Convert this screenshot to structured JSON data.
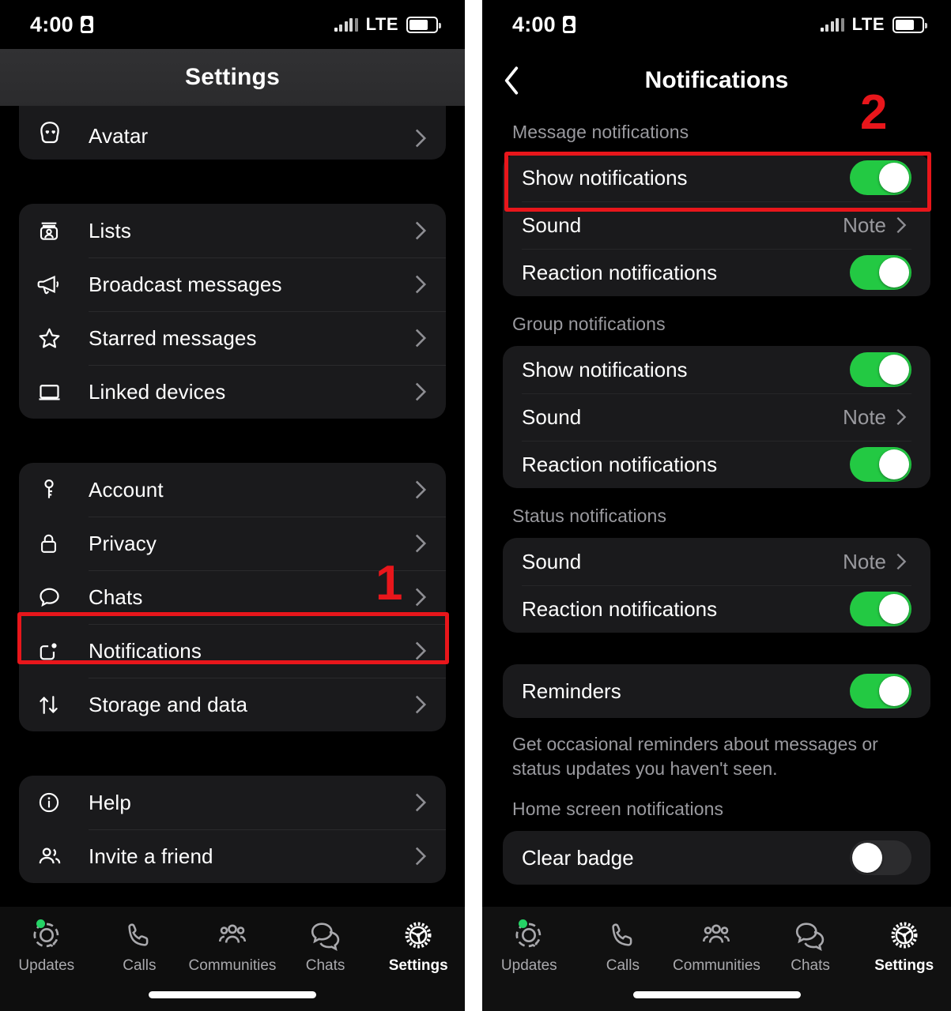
{
  "left_phone": {
    "status_bar": {
      "time": "4:00",
      "network": "LTE",
      "lock_icon": "sim-lock-icon"
    },
    "header": {
      "title": "Settings"
    },
    "groups": [
      {
        "id": "avatar-group",
        "items": [
          {
            "label": "Avatar",
            "icon": "avatar-face-icon"
          }
        ]
      },
      {
        "id": "tools-group",
        "items": [
          {
            "label": "Lists",
            "icon": "lists-icon"
          },
          {
            "label": "Broadcast messages",
            "icon": "megaphone-icon"
          },
          {
            "label": "Starred messages",
            "icon": "star-icon"
          },
          {
            "label": "Linked devices",
            "icon": "laptop-icon"
          }
        ]
      },
      {
        "id": "account-group",
        "items": [
          {
            "label": "Account",
            "icon": "key-icon"
          },
          {
            "label": "Privacy",
            "icon": "lock-icon"
          },
          {
            "label": "Chats",
            "icon": "chat-bubble-icon"
          },
          {
            "label": "Notifications",
            "icon": "notification-bell-square-icon"
          },
          {
            "label": "Storage and data",
            "icon": "arrows-up-down-icon"
          }
        ]
      },
      {
        "id": "help-group",
        "items": [
          {
            "label": "Help",
            "icon": "info-circle-icon"
          },
          {
            "label": "Invite a friend",
            "icon": "people-icon"
          }
        ]
      }
    ],
    "tabbar": [
      {
        "label": "Updates",
        "icon": "updates-status-icon",
        "active": false,
        "badge_dot": true
      },
      {
        "label": "Calls",
        "icon": "phone-icon",
        "active": false,
        "badge_dot": false
      },
      {
        "label": "Communities",
        "icon": "communities-icon",
        "active": false,
        "badge_dot": false
      },
      {
        "label": "Chats",
        "icon": "chats-icon",
        "active": false,
        "badge_dot": false
      },
      {
        "label": "Settings",
        "icon": "gear-icon",
        "active": true,
        "badge_dot": false
      }
    ]
  },
  "right_phone": {
    "status_bar": {
      "time": "4:00",
      "network": "LTE",
      "lock_icon": "sim-lock-icon"
    },
    "header": {
      "title": "Notifications",
      "back_icon": "back-chevron-icon"
    },
    "sections": [
      {
        "title": "Message notifications",
        "rows": [
          {
            "label": "Show notifications",
            "control": "toggle",
            "state": "on"
          },
          {
            "label": "Sound",
            "control": "value",
            "value": "Note"
          },
          {
            "label": "Reaction notifications",
            "control": "toggle",
            "state": "on"
          }
        ]
      },
      {
        "title": "Group notifications",
        "rows": [
          {
            "label": "Show notifications",
            "control": "toggle",
            "state": "on"
          },
          {
            "label": "Sound",
            "control": "value",
            "value": "Note"
          },
          {
            "label": "Reaction notifications",
            "control": "toggle",
            "state": "on"
          }
        ]
      },
      {
        "title": "Status notifications",
        "rows": [
          {
            "label": "Sound",
            "control": "value",
            "value": "Note"
          },
          {
            "label": "Reaction notifications",
            "control": "toggle",
            "state": "on"
          }
        ]
      },
      {
        "title": "",
        "rows": [
          {
            "label": "Reminders",
            "control": "toggle",
            "state": "on"
          }
        ],
        "helper": "Get occasional reminders about messages or status updates you haven't seen."
      },
      {
        "title": "Home screen notifications",
        "rows": [
          {
            "label": "Clear badge",
            "control": "toggle",
            "state": "off"
          }
        ]
      }
    ],
    "tabbar": [
      {
        "label": "Updates",
        "icon": "updates-status-icon",
        "active": false,
        "badge_dot": true
      },
      {
        "label": "Calls",
        "icon": "phone-icon",
        "active": false,
        "badge_dot": false
      },
      {
        "label": "Communities",
        "icon": "communities-icon",
        "active": false,
        "badge_dot": false
      },
      {
        "label": "Chats",
        "icon": "chats-icon",
        "active": false,
        "badge_dot": false
      },
      {
        "label": "Settings",
        "icon": "gear-icon",
        "active": true,
        "badge_dot": false
      }
    ]
  },
  "annotations": {
    "step_one": "1",
    "step_two": "2",
    "accent_color": "#e8161b"
  },
  "colors": {
    "toggle_on": "#23c943",
    "toggle_off": "#2c2c2e",
    "card": "#1a1a1c",
    "background": "#000000",
    "badge_dot": "#25d366",
    "secondary_text": "#9a9a9f"
  }
}
